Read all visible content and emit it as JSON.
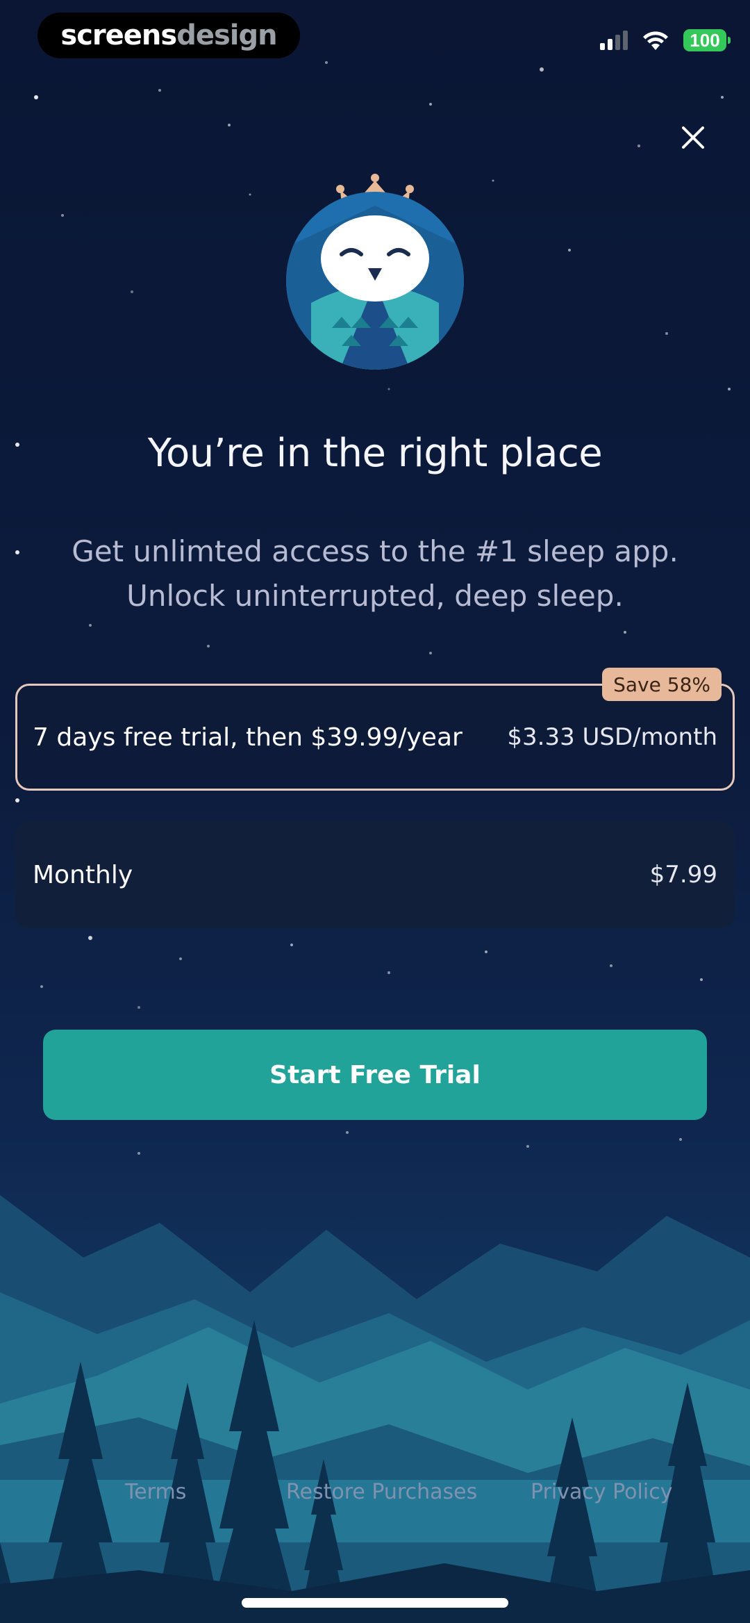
{
  "status_bar": {
    "brand_part1": "screens",
    "brand_part2": "design",
    "battery": "100"
  },
  "paywall": {
    "headline": "You’re in the right place",
    "subtitle_line1": "Get unlimted access to the #1 sleep app.",
    "subtitle_line2": "Unlock uninterrupted, deep sleep."
  },
  "plans": [
    {
      "label": "7 days free trial, then $39.99/year",
      "price": "$3.33 USD/month",
      "badge": "Save 58%",
      "selected": true
    },
    {
      "label": "Monthly",
      "price": "$7.99",
      "selected": false
    }
  ],
  "cta": {
    "label": "Start Free Trial"
  },
  "footer": {
    "terms": "Terms",
    "restore": "Restore Purchases",
    "privacy": "Privacy Policy"
  },
  "icons": {
    "close": "close-icon",
    "logo": "owl-crown-logo",
    "wifi": "wifi-icon",
    "signal": "cellular-signal-icon",
    "battery": "battery-icon"
  },
  "colors": {
    "background": "#0b1838",
    "cta": "#21a39a",
    "badge": "#e7b99a",
    "selected_border": "#e7c8bd"
  }
}
